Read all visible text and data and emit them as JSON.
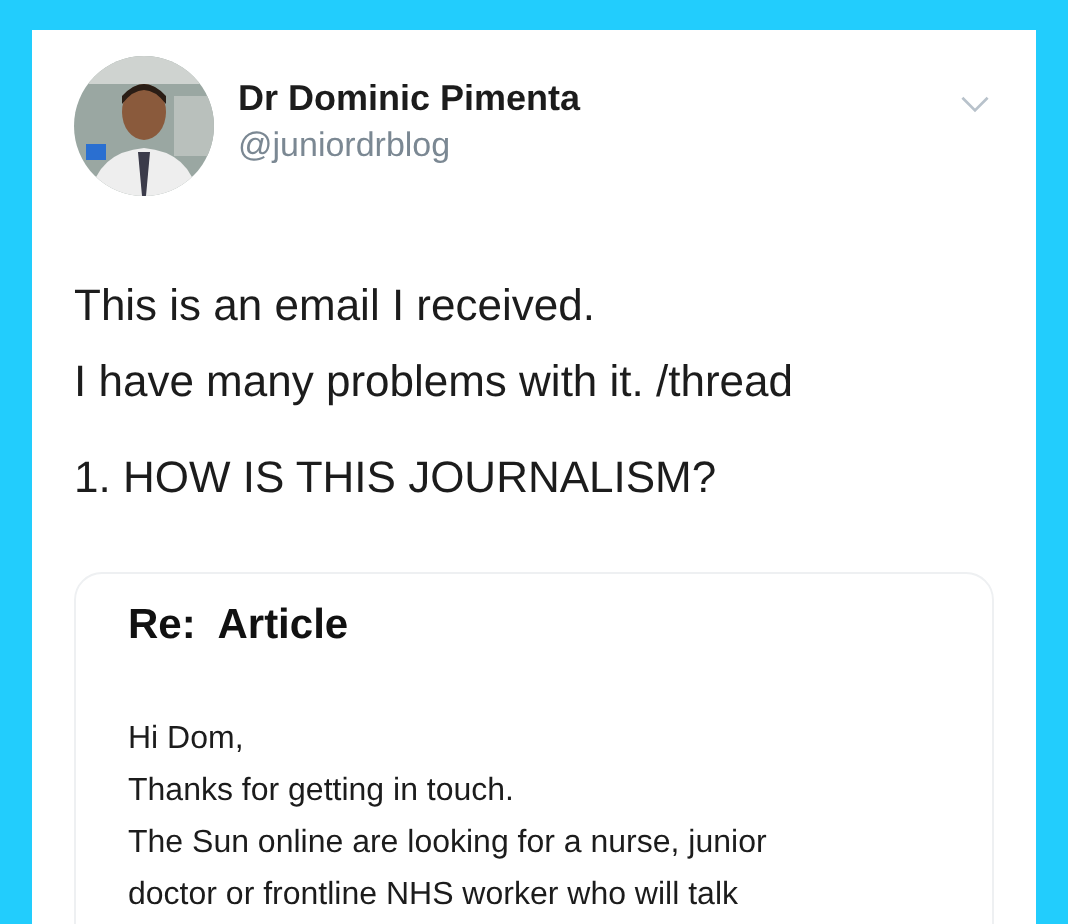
{
  "tweet": {
    "author": {
      "name": "Dr Dominic Pimenta",
      "handle": "@juniordrblog"
    },
    "text_lines": [
      "This is an email I received.",
      "I have many problems with it. /thread",
      "1. HOW IS THIS JOURNALISM?"
    ],
    "email": {
      "subject": "Re:  Article",
      "body_lines": [
        "Hi Dom,",
        "Thanks for getting in touch.",
        "The Sun online are looking for a nurse, junior",
        "doctor or frontline NHS worker who will talk"
      ]
    }
  }
}
